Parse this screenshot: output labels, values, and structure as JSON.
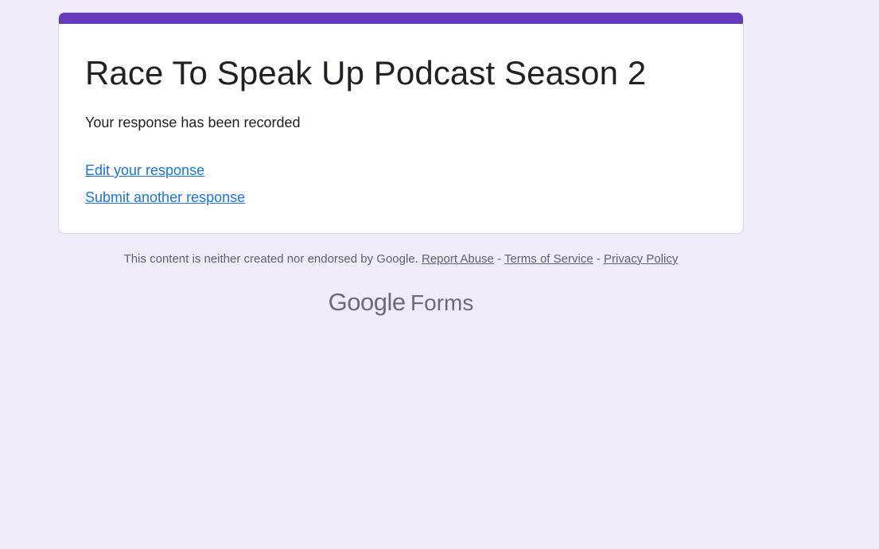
{
  "form": {
    "title": "Race To Speak Up Podcast Season 2",
    "confirmation": "Your response has been recorded",
    "edit_link": "Edit your response",
    "another_link": "Submit another response"
  },
  "footer": {
    "disclaimer": "This content is neither created nor endorsed by Google.",
    "report_abuse": "Report Abuse",
    "separator": " - ",
    "terms": "Terms of Service",
    "privacy": "Privacy Policy"
  },
  "brand": {
    "google": "Google",
    "forms": "Forms"
  },
  "colors": {
    "accent": "#673ab7",
    "background": "#efebf8",
    "link": "#1a73e8"
  }
}
